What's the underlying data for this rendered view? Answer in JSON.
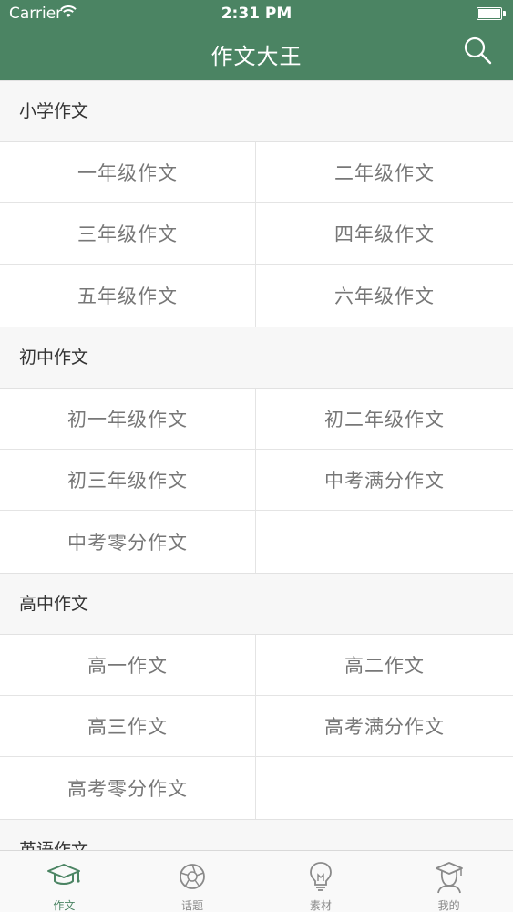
{
  "status_bar": {
    "carrier": "Carrier",
    "time": "2:31 PM"
  },
  "nav": {
    "title": "作文大王"
  },
  "sections": [
    {
      "title": "小学作文",
      "items": [
        "一年级作文",
        "二年级作文",
        "三年级作文",
        "四年级作文",
        "五年级作文",
        "六年级作文"
      ]
    },
    {
      "title": "初中作文",
      "items": [
        "初一年级作文",
        "初二年级作文",
        "初三年级作文",
        "中考满分作文",
        "中考零分作文",
        ""
      ]
    },
    {
      "title": "高中作文",
      "items": [
        "高一作文",
        "高二作文",
        "高三作文",
        "高考满分作文",
        "高考零分作文",
        ""
      ]
    },
    {
      "title": "英语作文"
    }
  ],
  "tabs": [
    {
      "label": "作文",
      "icon": "graduation-cap-icon",
      "active": true
    },
    {
      "label": "话题",
      "icon": "aperture-icon",
      "active": false
    },
    {
      "label": "素材",
      "icon": "lightbulb-icon",
      "active": false
    },
    {
      "label": "我的",
      "icon": "user-graduate-icon",
      "active": false
    }
  ],
  "colors": {
    "accent": "#4b8463",
    "tab_inactive": "#8a8a8a",
    "section_bg": "#f7f7f7"
  }
}
